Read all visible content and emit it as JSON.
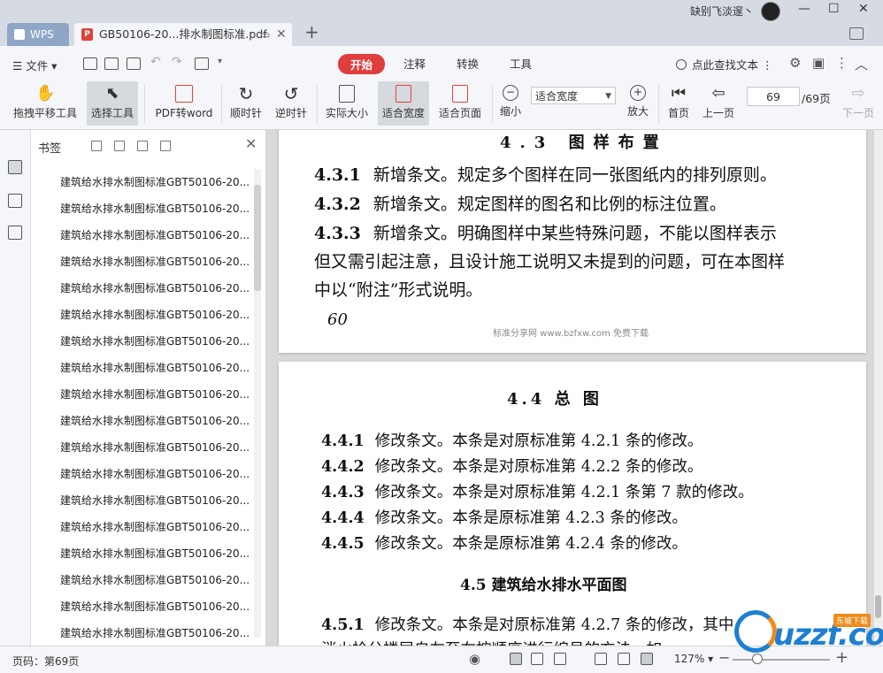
{
  "title_bar": {
    "wps_tab": "WPS",
    "doc_tab": "GB50106-20...排水制图标准.pdf",
    "user_name": "缺别飞淡邃丶"
  },
  "menu": {
    "file": "文件",
    "tabs": [
      "开始",
      "注释",
      "转换",
      "工具"
    ],
    "active_tab": "开始",
    "search": "点此查找文本"
  },
  "toolbar": {
    "pan": "拖拽平移工具",
    "select": "选择工具",
    "pdf2word": "PDF转word",
    "rotate_cw": "顺时针",
    "rotate_ccw": "逆时针",
    "actual_size": "实际大小",
    "fit_width": "适合宽度",
    "fit_page": "适合页面",
    "zoom_out": "缩小",
    "zoom_mode": "适合宽度",
    "zoom_in": "放大",
    "first_page": "首页",
    "prev_page": "上一页",
    "next_page": "下一页",
    "current_page": "69",
    "total_pages": "/69页"
  },
  "bookmarks": {
    "title": "书签",
    "items": [
      "建筑给水排水制图标准GBT50106-20...",
      "建筑给水排水制图标准GBT50106-20...",
      "建筑给水排水制图标准GBT50106-20...",
      "建筑给水排水制图标准GBT50106-20...",
      "建筑给水排水制图标准GBT50106-20...",
      "建筑给水排水制图标准GBT50106-20...",
      "建筑给水排水制图标准GBT50106-20...",
      "建筑给水排水制图标准GBT50106-20...",
      "建筑给水排水制图标准GBT50106-20...",
      "建筑给水排水制图标准GBT50106-20...",
      "建筑给水排水制图标准GBT50106-20...",
      "建筑给水排水制图标准GBT50106-20...",
      "建筑给水排水制图标准GBT50106-20...",
      "建筑给水排水制图标准GBT50106-20...",
      "建筑给水排水制图标准GBT50106-20...",
      "建筑给水排水制图标准GBT50106-20...",
      "建筑给水排水制图标准GBT50106-20...",
      "建筑给水排水制图标准GBT50106-20..."
    ]
  },
  "page1": {
    "heading": "4.3 图样布置",
    "clauses": [
      {
        "num": "4.3.1",
        "text": "新增条文。规定多个图样在同一张图纸内的排列原则。"
      },
      {
        "num": "4.3.2",
        "text": "新增条文。规定图样的图名和比例的标注位置。"
      },
      {
        "num": "4.3.3",
        "text": "新增条文。明确图样中某些特殊问题，不能以图样表示"
      }
    ],
    "continuation": [
      "但又需引起注意，且设计施工说明又未提到的问题，可在本图样",
      "中以“附注”形式说明。"
    ],
    "page_number": "60",
    "watermark": "标准分享网 www.bzfxw.com 免费下载"
  },
  "page2": {
    "heading": "4.4 总 图",
    "clauses": [
      {
        "num": "4.4.1",
        "text": "修改条文。本条是对原标准第 4.2.1 条的修改。"
      },
      {
        "num": "4.4.2",
        "text": "修改条文。本条是对原标准第 4.2.2 条的修改。"
      },
      {
        "num": "4.4.3",
        "text": "修改条文。本条是对原标准第 4.2.1 条第 7 款的修改。"
      },
      {
        "num": "4.4.4",
        "text": "修改条文。本条是原标准第 4.2.3 条的修改。"
      },
      {
        "num": "4.4.5",
        "text": "修改条文。本条是原标准第 4.2.4 条的修改。"
      }
    ],
    "heading2": "4.5 建筑给水排水平面图",
    "clause_451": {
      "num": "4.5.1",
      "text": "修改条文。本条是对原标准第 4.2.7 条的修改，其中"
    },
    "partial_line": "消火栓分楼层自左至右按顺序进行编号的方法，如…"
  },
  "status": {
    "page_label": "页码：第69页",
    "zoom": "127%"
  },
  "logo": {
    "text": "uzzf.com",
    "tag": "东坡下载"
  },
  "colors": {
    "accent": "#e03d3d",
    "toolbar_bg": "#f4f6f9",
    "titlebar_bg": "#d6dbe3"
  }
}
